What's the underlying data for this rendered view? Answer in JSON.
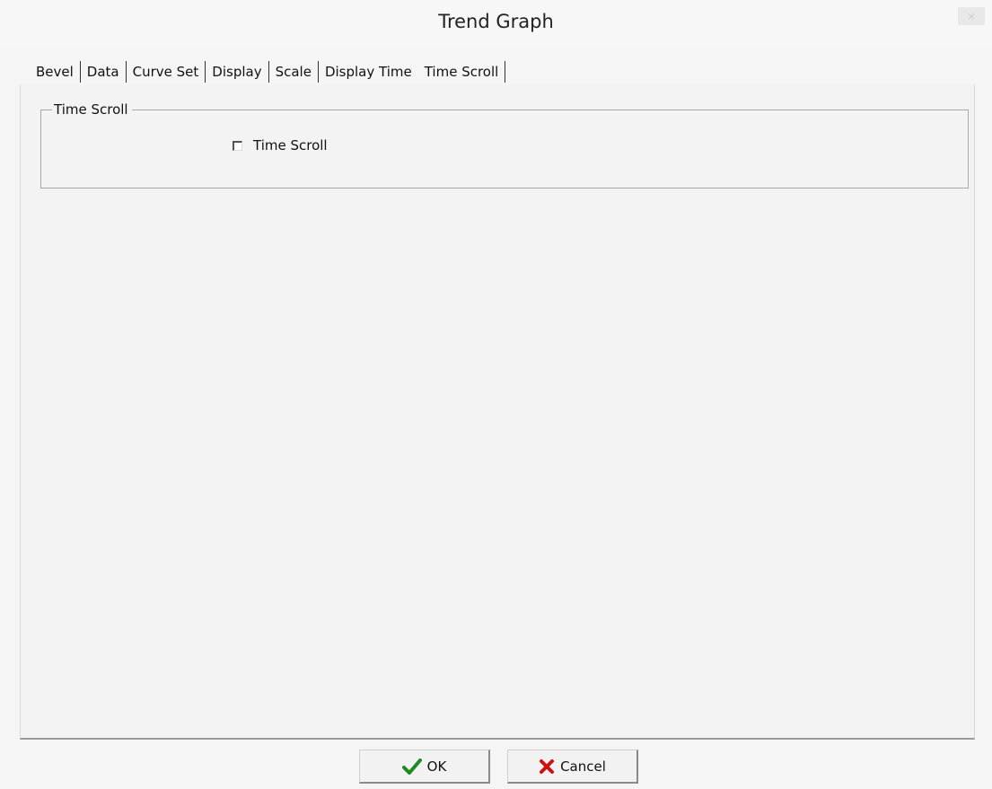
{
  "window": {
    "title": "Trend Graph",
    "close_glyph": "×"
  },
  "tabs": [
    {
      "label": "Bevel"
    },
    {
      "label": "Data"
    },
    {
      "label": "Curve Set"
    },
    {
      "label": "Display"
    },
    {
      "label": "Scale"
    },
    {
      "label": "Display Time"
    },
    {
      "label": "Time Scroll",
      "active": true
    }
  ],
  "panel": {
    "group_title": "Time Scroll",
    "checkbox_label": "Time Scroll",
    "checkbox_checked": false
  },
  "buttons": {
    "ok_label": "OK",
    "ok_icon": "checkmark-icon",
    "ok_icon_color": "#1f8a1f",
    "cancel_label": "Cancel",
    "cancel_icon": "x-icon",
    "cancel_icon_color": "#cc1111"
  }
}
